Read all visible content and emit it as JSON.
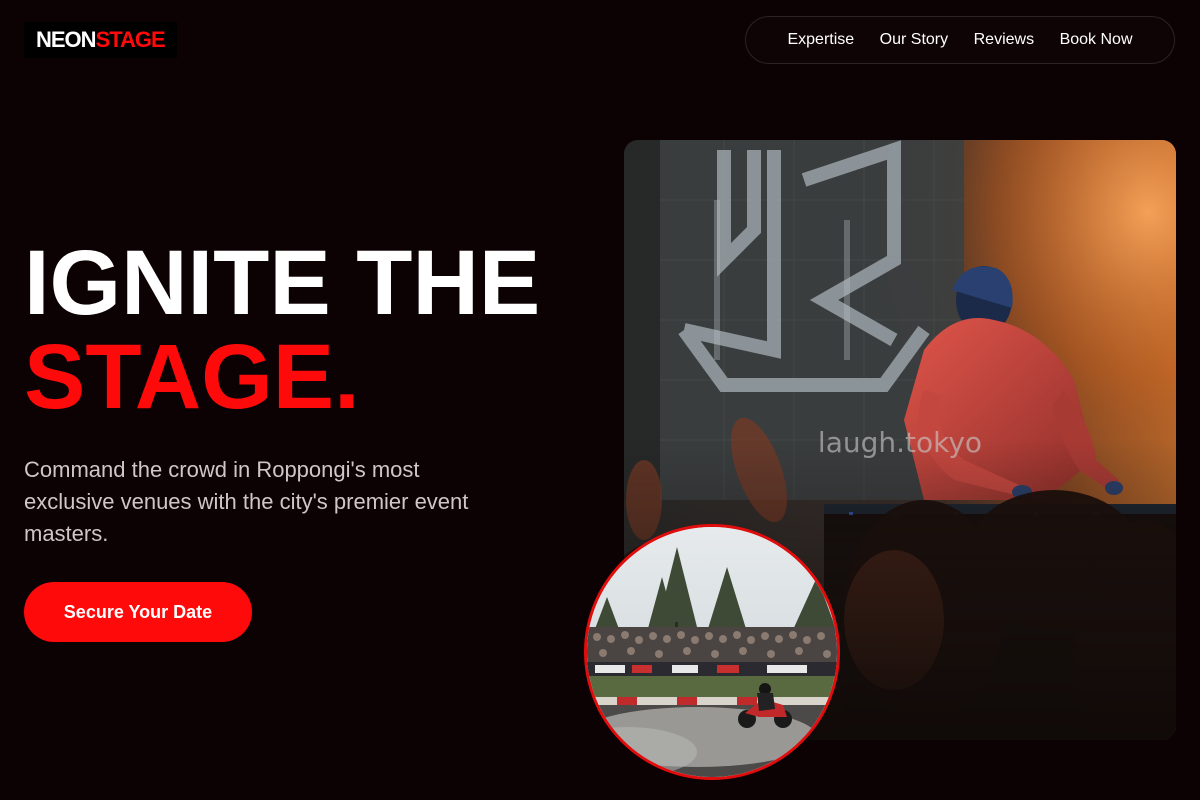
{
  "brand": {
    "logo_part1": "NEON",
    "logo_part2": "STAGE",
    "accent_color": "#ff0a0a",
    "background_color": "#0c0103"
  },
  "nav": {
    "items": [
      {
        "label": "Expertise"
      },
      {
        "label": "Our Story"
      },
      {
        "label": "Reviews"
      },
      {
        "label": "Book Now"
      }
    ]
  },
  "hero": {
    "headline_line1": "IGNITE THE",
    "headline_line2": "STAGE.",
    "subtext": "Command the crowd in Roppongi's most exclusive venues with the city's premier event masters.",
    "cta_label": "Secure Your Date"
  },
  "images": {
    "main_photo": {
      "watermark": "laugh.tokyo"
    },
    "inset_photo": {}
  }
}
